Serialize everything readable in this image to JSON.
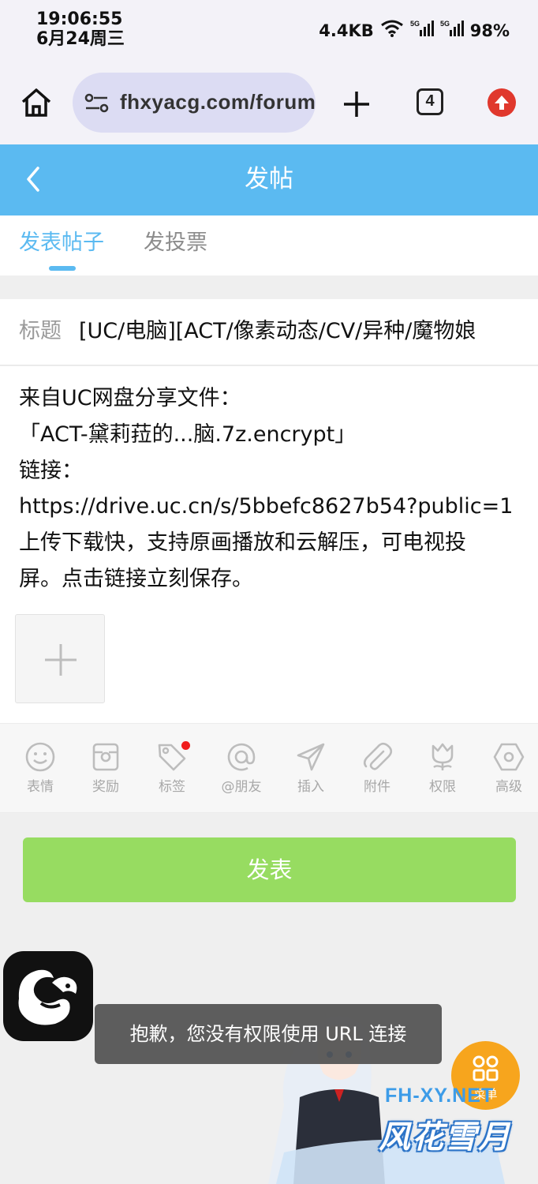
{
  "status_bar": {
    "time": "19:06:55",
    "date": "6月24周三",
    "net_speed": "4.4KB",
    "battery": "98%"
  },
  "browser": {
    "url": "fhxyacg.com/forum",
    "tab_count": "4"
  },
  "header": {
    "title": "发帖"
  },
  "tabs": [
    {
      "label": "发表帖子",
      "active": true
    },
    {
      "label": "发投票",
      "active": false
    }
  ],
  "form": {
    "title_label": "标题",
    "title_value": "[UC/电脑][ACT/像素动态/CV/异种/魔物娘",
    "content_lines": [
      "来自UC网盘分享文件：",
      "「ACT-黛莉菈的...脑.7z.encrypt」",
      "链接：",
      "https://drive.uc.cn/s/5bbefc8627b54?public=1",
      "上传下载快，支持原画播放和云解压，可电视投",
      "屏。点击链接立刻保存。"
    ]
  },
  "toolbar": [
    {
      "label": "表情",
      "icon": "emoji-icon"
    },
    {
      "label": "奖励",
      "icon": "reward-icon"
    },
    {
      "label": "标签",
      "icon": "tag-icon"
    },
    {
      "label": "@朋友",
      "icon": "at-icon"
    },
    {
      "label": "插入",
      "icon": "send-icon"
    },
    {
      "label": "附件",
      "icon": "paperclip-icon"
    },
    {
      "label": "权限",
      "icon": "tulip-icon"
    },
    {
      "label": "高级",
      "icon": "hexagon-icon"
    }
  ],
  "submit_label": "发表",
  "toast": "抱歉，您没有权限使用 URL 连接",
  "menu_float_label": "菜单",
  "watermark": {
    "latin": "FH-XY.NET",
    "chinese": "风花雪月"
  },
  "colors": {
    "header_blue": "#5bbaf1",
    "submit_green": "#97dc61",
    "menu_orange": "#f7a51d"
  }
}
